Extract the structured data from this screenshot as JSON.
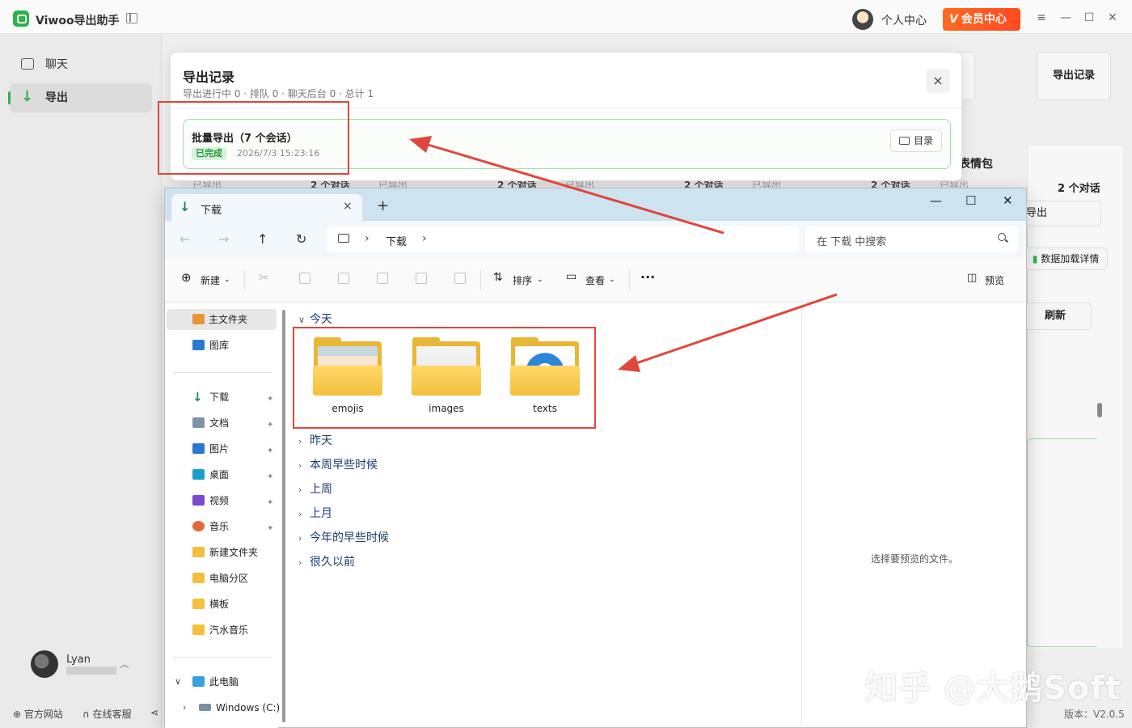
{
  "app": {
    "title": "Viwoo导出助手",
    "profile_label": "个人中心",
    "vip_mark": "V",
    "vip_label": "会员中心",
    "version": "版本：V2.0.5",
    "watermark": "知乎 @大鹅Soft"
  },
  "sidebar": {
    "items": [
      {
        "label": "聊天"
      },
      {
        "label": "导出"
      }
    ],
    "user_name": "Lyan",
    "footer": [
      {
        "label": "官方网站"
      },
      {
        "label": "在线客服"
      }
    ]
  },
  "background": {
    "export_records_button": "导出记录",
    "emoji_heading": "表情包",
    "dialog_count": "2 个对话",
    "export_label": "导出",
    "data_details": "数据加载详情",
    "refresh": "刷新",
    "stats_row": [
      {
        "left": "已导出",
        "right": "2 个对话"
      },
      {
        "left": "已导出",
        "right": "2 个对话"
      },
      {
        "left": "已导出",
        "right": "2 个对话"
      },
      {
        "left": "已导出",
        "right": "2 个对话"
      },
      {
        "left": "已导出",
        "right": ""
      }
    ]
  },
  "export_popup": {
    "title": "导出记录",
    "summary": "导出进行中 0 · 排队 0 · 聊天后台 0 · 总计 1",
    "close": "×",
    "record": {
      "title": "批量导出（7 个会话）",
      "status": "已完成",
      "time": "2026/7/3 15:23:16",
      "dir_button": "目录"
    }
  },
  "explorer": {
    "tab_label": "下载",
    "tab_close": "×",
    "new_tab": "+",
    "win_controls": [
      "—",
      "☐",
      "✕"
    ],
    "breadcrumb": [
      "下载"
    ],
    "search_placeholder": "在 下载 中搜索",
    "commands": {
      "new": "新建",
      "sort": "排序",
      "view": "查看",
      "more": "···",
      "preview": "预览"
    },
    "nav": {
      "home": "主文件夹",
      "gallery": "图库",
      "pinned": [
        {
          "label": "下载"
        },
        {
          "label": "文档"
        },
        {
          "label": "图片"
        },
        {
          "label": "桌面"
        },
        {
          "label": "视频"
        },
        {
          "label": "音乐"
        }
      ],
      "folders": [
        {
          "label": "新建文件夹"
        },
        {
          "label": "电脑分区"
        },
        {
          "label": "横板"
        },
        {
          "label": "汽水音乐"
        }
      ],
      "this_pc": "此电脑",
      "drive": "Windows (C:)"
    },
    "groups": [
      {
        "label": "今天"
      },
      {
        "label": "昨天"
      },
      {
        "label": "本周早些时候"
      },
      {
        "label": "上周"
      },
      {
        "label": "上月"
      },
      {
        "label": "今年的早些时候"
      },
      {
        "label": "很久以前"
      }
    ],
    "folders": [
      {
        "name": "emojis"
      },
      {
        "name": "images"
      },
      {
        "name": "texts"
      }
    ],
    "preview_hint": "选择要预览的文件。"
  },
  "colors": {
    "accent_green": "#2bb34a",
    "vip_orange": "#ff5a1f",
    "annotation_red": "#e1463a",
    "folder_yellow": "#f3c03e"
  }
}
